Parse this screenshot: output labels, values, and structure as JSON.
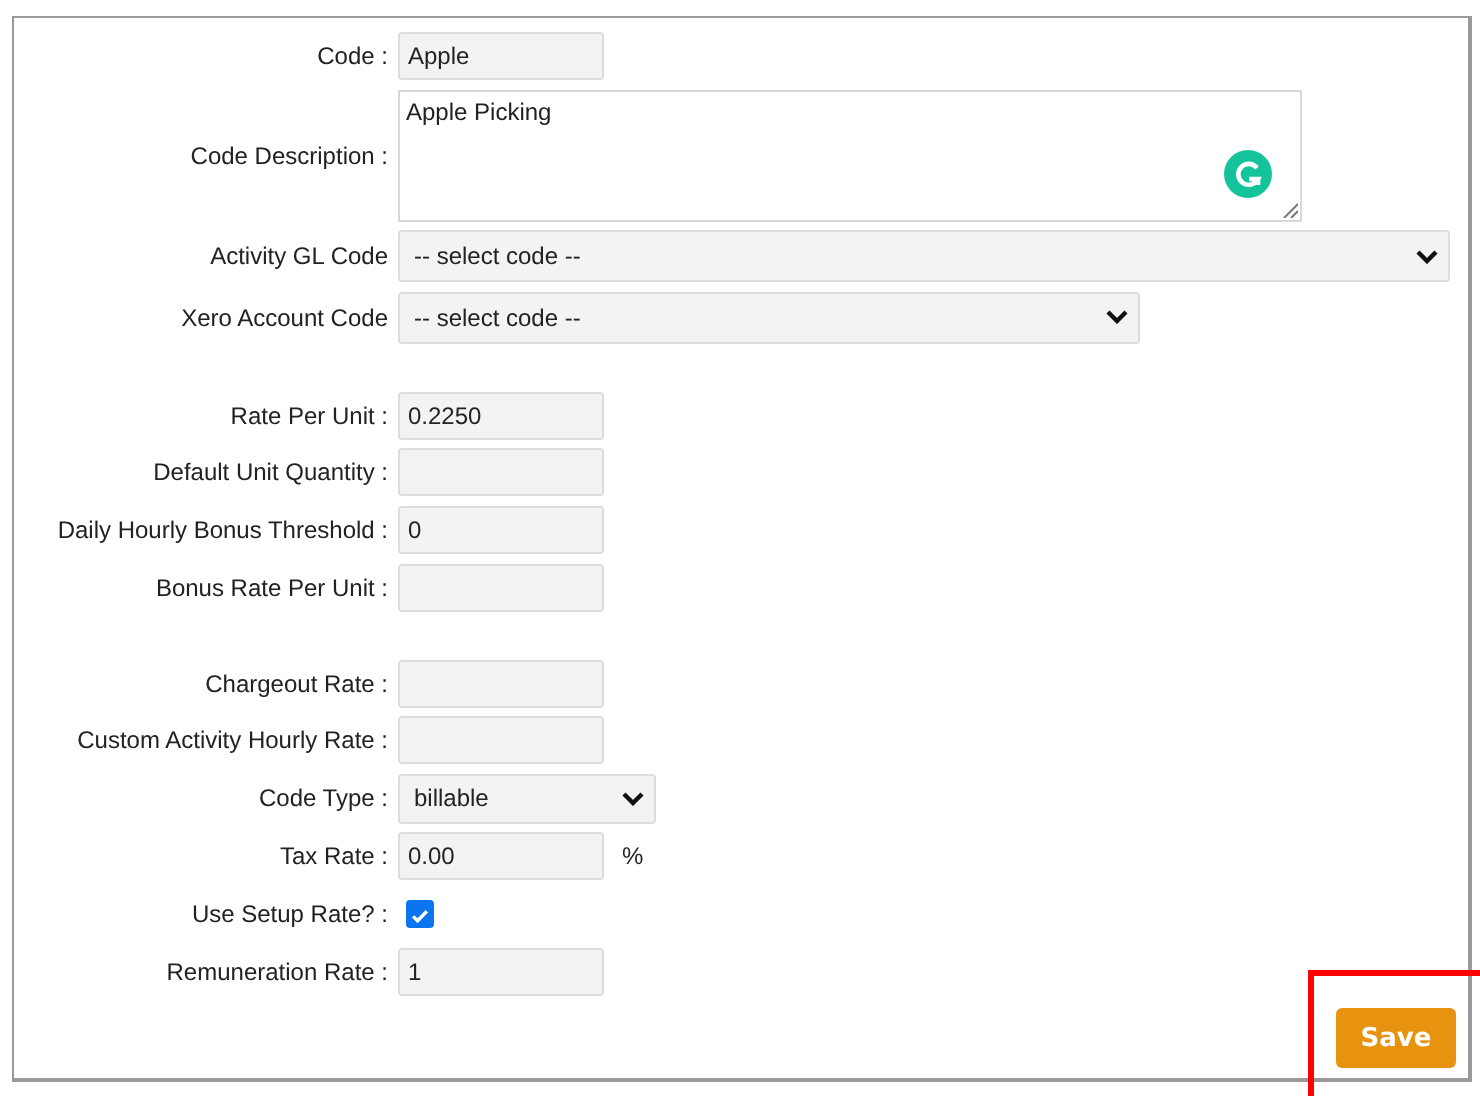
{
  "sections": [
    [
      {
        "kind": "text",
        "label": "Code :",
        "value": "Apple"
      },
      {
        "kind": "textarea",
        "label": "Code Description :",
        "value": "Apple Picking"
      },
      {
        "kind": "select",
        "label": "Activity GL Code",
        "value": "-- select code --"
      },
      {
        "kind": "select",
        "label": "Xero Account Code",
        "value": "-- select code --"
      }
    ],
    [
      {
        "kind": "text",
        "label": "Rate Per Unit :",
        "value": "0.2250"
      },
      {
        "kind": "text",
        "label": "Default Unit Quantity :"
      },
      {
        "kind": "text",
        "label": "Daily Hourly Bonus Threshold :",
        "value": "0"
      },
      {
        "kind": "text",
        "label": "Bonus Rate Per Unit :"
      }
    ],
    [
      {
        "kind": "text",
        "label": "Chargeout Rate :"
      },
      {
        "kind": "text",
        "label": "Custom Activity Hourly Rate :"
      },
      {
        "kind": "select",
        "label": "Code Type :",
        "value": "billable"
      },
      {
        "kind": "text",
        "label": "Tax Rate :",
        "value": "0.00",
        "suffix": "%"
      },
      {
        "kind": "checkbox",
        "label": "Use Setup Rate? :",
        "checked": true
      },
      {
        "kind": "text",
        "label": "Remuneration Rate :",
        "value": "1"
      }
    ]
  ],
  "save_button": {
    "label": "Save",
    "highlighted": true
  }
}
